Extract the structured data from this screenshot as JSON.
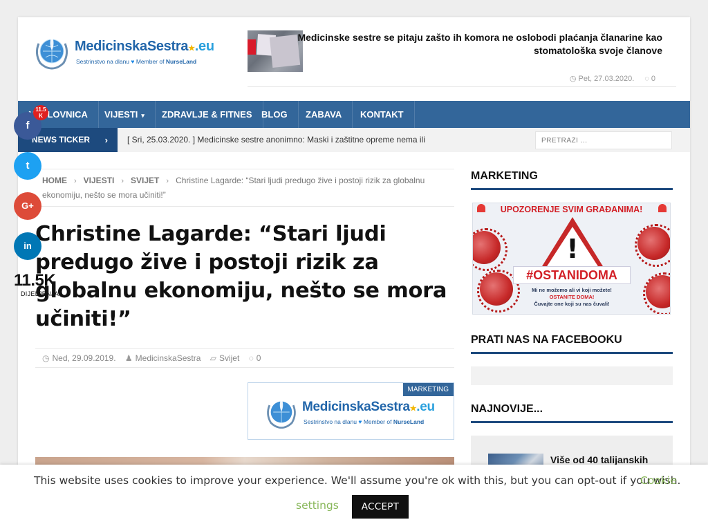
{
  "brand": {
    "name": "MedicinskaSestra",
    "tld": ".eu",
    "tagline_left": "Sestrinstvo na dlanu",
    "tagline_mid": "Member of",
    "tagline_right": "NurseLand"
  },
  "header_news": {
    "title": "Medicinske sestre se pitaju zašto ih komora ne oslobodi plaćanja članarine kao stomatološka svoje članove",
    "date": "Pet, 27.03.2020.",
    "comments": "0"
  },
  "nav": {
    "items": [
      {
        "label": "NASLOVNICA"
      },
      {
        "label": "VIJESTI",
        "has_dropdown": true
      },
      {
        "label": "ZDRAVLJE & FITNES"
      },
      {
        "label": "BLOG"
      },
      {
        "label": "ZABAVA"
      },
      {
        "label": "KONTAKT"
      }
    ]
  },
  "ticker": {
    "label": "NEWS TICKER",
    "text": "[ Sri, 25.03.2020. ]  Medicinske sestre anonimno: Maski i zaštitne opreme nema ili"
  },
  "search": {
    "placeholder": "PRETRAŽI ..."
  },
  "breadcrumb": {
    "items": [
      "HOME",
      "VIJESTI",
      "SVIJET"
    ],
    "current": "Christine Lagarde: “Stari ljudi predugo žive i postoji rizik za globalnu ekonomiju, nešto se mora učiniti!”"
  },
  "article": {
    "title": "Christine Lagarde: “Stari ljudi predugo žive i postoji rizik za globalnu ekonomiju, nešto se mora učiniti!”",
    "date": "Ned, 29.09.2019.",
    "author": "MedicinskaSestra",
    "category": "Svijet",
    "comments": "0"
  },
  "ad": {
    "tag": "MARKETING"
  },
  "share": {
    "badge": "11.5 K",
    "count": "11.5K",
    "label": "DIJELJENJA",
    "buttons": [
      "f",
      "t",
      "G+",
      "in"
    ],
    "colors": {
      "facebook": "#3b5998",
      "twitter": "#1da1f2",
      "google": "#dd4b39",
      "linkedin": "#0077b5"
    }
  },
  "sidebar": {
    "marketing_heading": "MARKETING",
    "banner": {
      "headline": "UPOZORENJE SVIM GRAĐANIMA!",
      "hashtag": "#OSTANIDOMA",
      "line1": "Mi ne možemo ali vi koji možete!",
      "line2": "OSTANITE DOMA!",
      "line3": "Čuvajte one koji su nas čuvali!"
    },
    "facebook_heading": "PRATI NAS NA FACEBOOKU",
    "latest_heading": "NAJNOVIJE...",
    "latest_item": "Više od 40 talijanskih"
  },
  "cookie": {
    "text": "This website uses cookies to improve your experience. We'll assume you're ok with this, but you can opt-out if you wish.",
    "link_part1": "Cookie",
    "link_part2": "settings",
    "accept": "ACCEPT"
  },
  "colors": {
    "nav": "#33669a",
    "ticker_label": "#1d4a7e",
    "cookie_link": "#88b75a",
    "accept_bg": "#111111"
  }
}
